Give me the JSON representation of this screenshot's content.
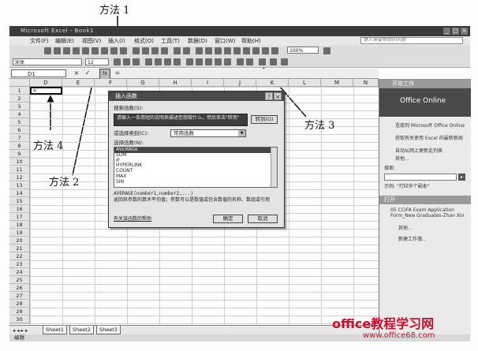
{
  "window": {
    "title": "Microsoft Excel - Book1",
    "controls": [
      "_",
      "□",
      "×"
    ]
  },
  "menubar": {
    "items": [
      "文件(F)",
      "编辑(E)",
      "视图(V)",
      "插入(I)",
      "格式(O)",
      "工具(T)",
      "数据(D)",
      "窗口(W)",
      "帮助(H)"
    ],
    "help_placeholder": "键入需要帮助的问题"
  },
  "toolbar": {
    "zoom": "100%",
    "font_name": "宋体",
    "font_size": "12"
  },
  "formula_bar": {
    "name_box": "D1",
    "cancel": "×",
    "enter": "✓",
    "fx": "fx",
    "content": "="
  },
  "grid": {
    "columns": [
      "D",
      "E",
      "F",
      "G",
      "H",
      "I",
      "J",
      "K",
      "L",
      "M",
      "N"
    ],
    "rows": [
      "1",
      "2",
      "3",
      "4",
      "5",
      "6",
      "7",
      "8",
      "9",
      "10",
      "11",
      "12",
      "13",
      "14",
      "15",
      "16",
      "17",
      "18",
      "19",
      "20",
      "21",
      "22",
      "23",
      "24",
      "25",
      "26",
      "27",
      "28",
      "29",
      "30"
    ],
    "active_value": "="
  },
  "dialog": {
    "title": "插入函数",
    "search_label": "搜索函数(S):",
    "search_text": "请输入一条简短的说明来描述您想做什么，然后单击\"转到\"",
    "go_button": "转到(G)",
    "category_label": "或选择类别(C):",
    "category_value": "常用函数",
    "select_label": "选择函数(N):",
    "functions": [
      "AVERAGE",
      "SUM",
      "IF",
      "HYPERLINK",
      "COUNT",
      "MAX",
      "SIN"
    ],
    "selected_function": "AVERAGE",
    "syntax": "AVERAGE(number1,number2,...)",
    "description": "返回其参数的算术平均值；参数可以是数值或包含数值的名称、数组或引用",
    "help_link": "有关该函数的帮助",
    "ok_button": "确定",
    "cancel_button": "取消"
  },
  "task_pane": {
    "header": "开始工作",
    "logo": "Office Online",
    "links": [
      "连接到 Microsoft Office Online",
      "获取有关使用 Excel 的最新新闻",
      "自动从网上更新此列表"
    ],
    "more": "其他...",
    "search_label": "搜索:",
    "example": "示例: \"打印多个副本\"",
    "open_header": "打开",
    "recent_file": "05 CCIFA Exam Application Form_New Graduates-Zhan Xin",
    "other": "其他...",
    "new_workbook": "新建工作簿..."
  },
  "sheets": {
    "nav": "◂ ◂ ▸ ▸",
    "tabs": [
      "Sheet1",
      "Sheet2",
      "Sheet3"
    ]
  },
  "status": {
    "mode": "编辑"
  },
  "annotations": {
    "method1": "方法 1",
    "method2": "方法 2",
    "method3": "方法 3",
    "method4": "方法 4"
  },
  "watermark": {
    "line1": "office教程学习网",
    "line2": "www.office68.com",
    "color": "#c8102e"
  }
}
